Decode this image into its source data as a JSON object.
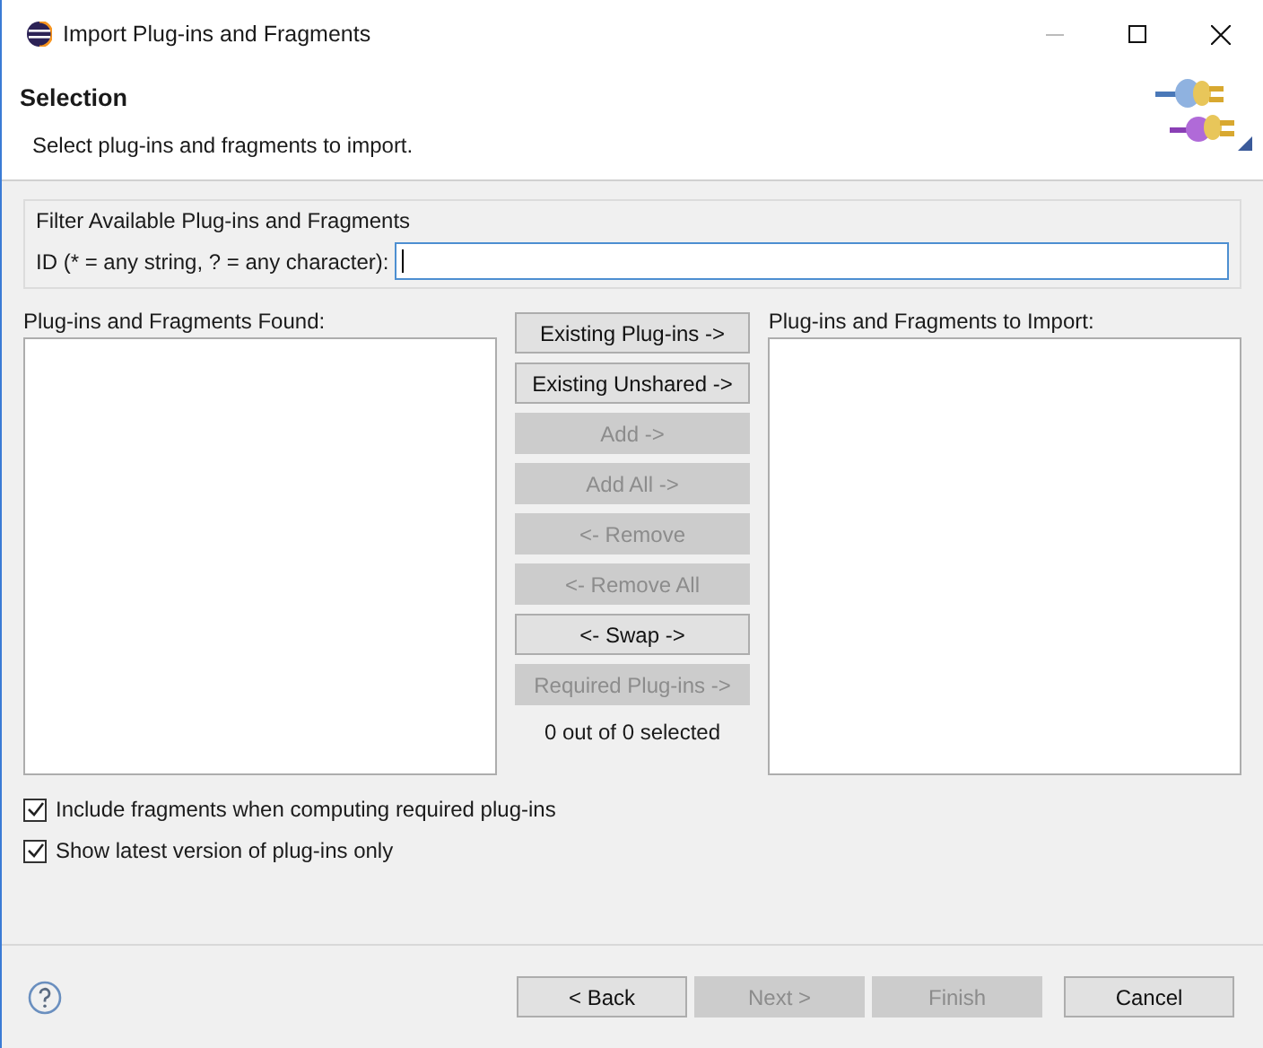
{
  "window": {
    "title": "Import Plug-ins and Fragments"
  },
  "header": {
    "title": "Selection",
    "description": "Select plug-ins and fragments to import."
  },
  "filter": {
    "group_label": "Filter Available Plug-ins and Fragments",
    "field_label": "ID (* = any string, ? = any character):"
  },
  "found_list": {
    "label": "Plug-ins and Fragments Found:"
  },
  "import_list": {
    "label": "Plug-ins and Fragments to Import:"
  },
  "middle_buttons": [
    {
      "label": "Existing Plug-ins ->",
      "disabled": false
    },
    {
      "label": "Existing Unshared ->",
      "disabled": false
    },
    {
      "label": "Add ->",
      "disabled": true
    },
    {
      "label": "Add All ->",
      "disabled": true
    },
    {
      "label": "<- Remove",
      "disabled": true
    },
    {
      "label": "<- Remove All",
      "disabled": true
    },
    {
      "label": "<- Swap ->",
      "disabled": false
    },
    {
      "label": "Required Plug-ins ->",
      "disabled": true
    }
  ],
  "selection_count": "0 out of 0 selected",
  "options": [
    {
      "label": "Include fragments when computing required plug-ins",
      "checked": true
    },
    {
      "label": "Show latest version of plug-ins only",
      "checked": true
    }
  ],
  "footer_buttons": [
    {
      "label": "< Back",
      "disabled": false
    },
    {
      "label": "Next >",
      "disabled": true
    },
    {
      "label": "Finish",
      "disabled": true
    },
    {
      "label": "Cancel",
      "disabled": false
    }
  ]
}
